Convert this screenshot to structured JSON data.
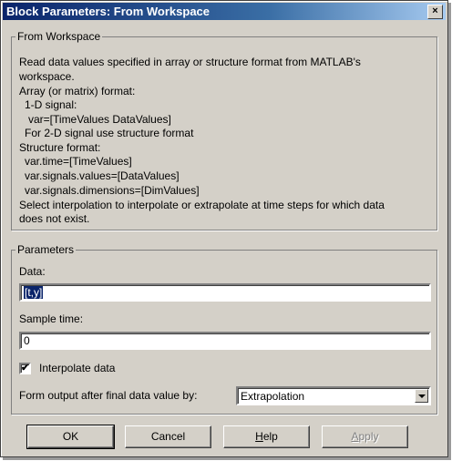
{
  "window": {
    "title": "Block Parameters: From Workspace",
    "close_glyph": "×"
  },
  "workspace_group": {
    "legend": "From Workspace",
    "description_lines": [
      "Read data values specified in array or structure format from MATLAB's",
      "workspace.",
      "Array (or matrix) format:",
      "  1-D signal:",
      "    var=[TimeValues DataValues]",
      "  For 2-D signal use structure format",
      "Structure format:",
      "  var.time=[TimeValues]",
      "  var.signals.values=[DataValues]",
      "  var.signals.dimensions=[DimValues]",
      "Select interpolation to interpolate or extrapolate at time steps for which data",
      "does not exist."
    ]
  },
  "parameters_group": {
    "legend": "Parameters",
    "data_label": "Data:",
    "data_value": "[t,y]",
    "sample_time_label": "Sample time:",
    "sample_time_value": "0",
    "interpolate_label": "Interpolate data",
    "interpolate_checked": true,
    "check_glyph": "✔",
    "form_output_label": "Form output after final data value by:",
    "form_output_value": "Extrapolation"
  },
  "buttons": {
    "ok": "OK",
    "cancel": "Cancel",
    "help_accel": "H",
    "help_rest": "elp",
    "apply_accel": "A",
    "apply_rest": "pply"
  }
}
